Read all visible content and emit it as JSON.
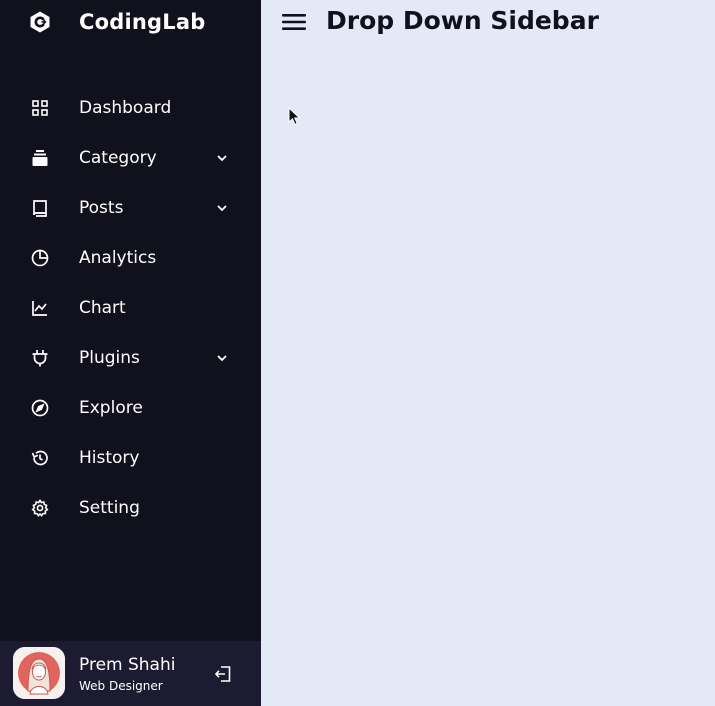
{
  "logo": {
    "name": "CodingLab",
    "icon": "codinglab-logo-icon"
  },
  "sidebar": {
    "items": [
      {
        "label": "Dashboard",
        "icon": "grid-icon",
        "has_submenu": false
      },
      {
        "label": "Category",
        "icon": "collection-icon",
        "has_submenu": true
      },
      {
        "label": "Posts",
        "icon": "book-icon",
        "has_submenu": true
      },
      {
        "label": "Analytics",
        "icon": "pie-chart-icon",
        "has_submenu": false
      },
      {
        "label": "Chart",
        "icon": "line-chart-icon",
        "has_submenu": false
      },
      {
        "label": "Plugins",
        "icon": "plug-icon",
        "has_submenu": true
      },
      {
        "label": "Explore",
        "icon": "compass-icon",
        "has_submenu": false
      },
      {
        "label": "History",
        "icon": "history-icon",
        "has_submenu": false
      },
      {
        "label": "Setting",
        "icon": "cog-icon",
        "has_submenu": false
      }
    ]
  },
  "profile": {
    "name": "Prem Shahi",
    "job": "Web Designer",
    "logout_icon": "logout-icon"
  },
  "main": {
    "title": "Drop Down Sidebar",
    "menu_icon": "hamburger-menu-icon"
  },
  "colors": {
    "sidebar_bg": "#11101d",
    "profile_bg": "#1d1b31",
    "main_bg": "#e4e9f7",
    "text_light": "#ffffff",
    "text_dark": "#11101d"
  }
}
